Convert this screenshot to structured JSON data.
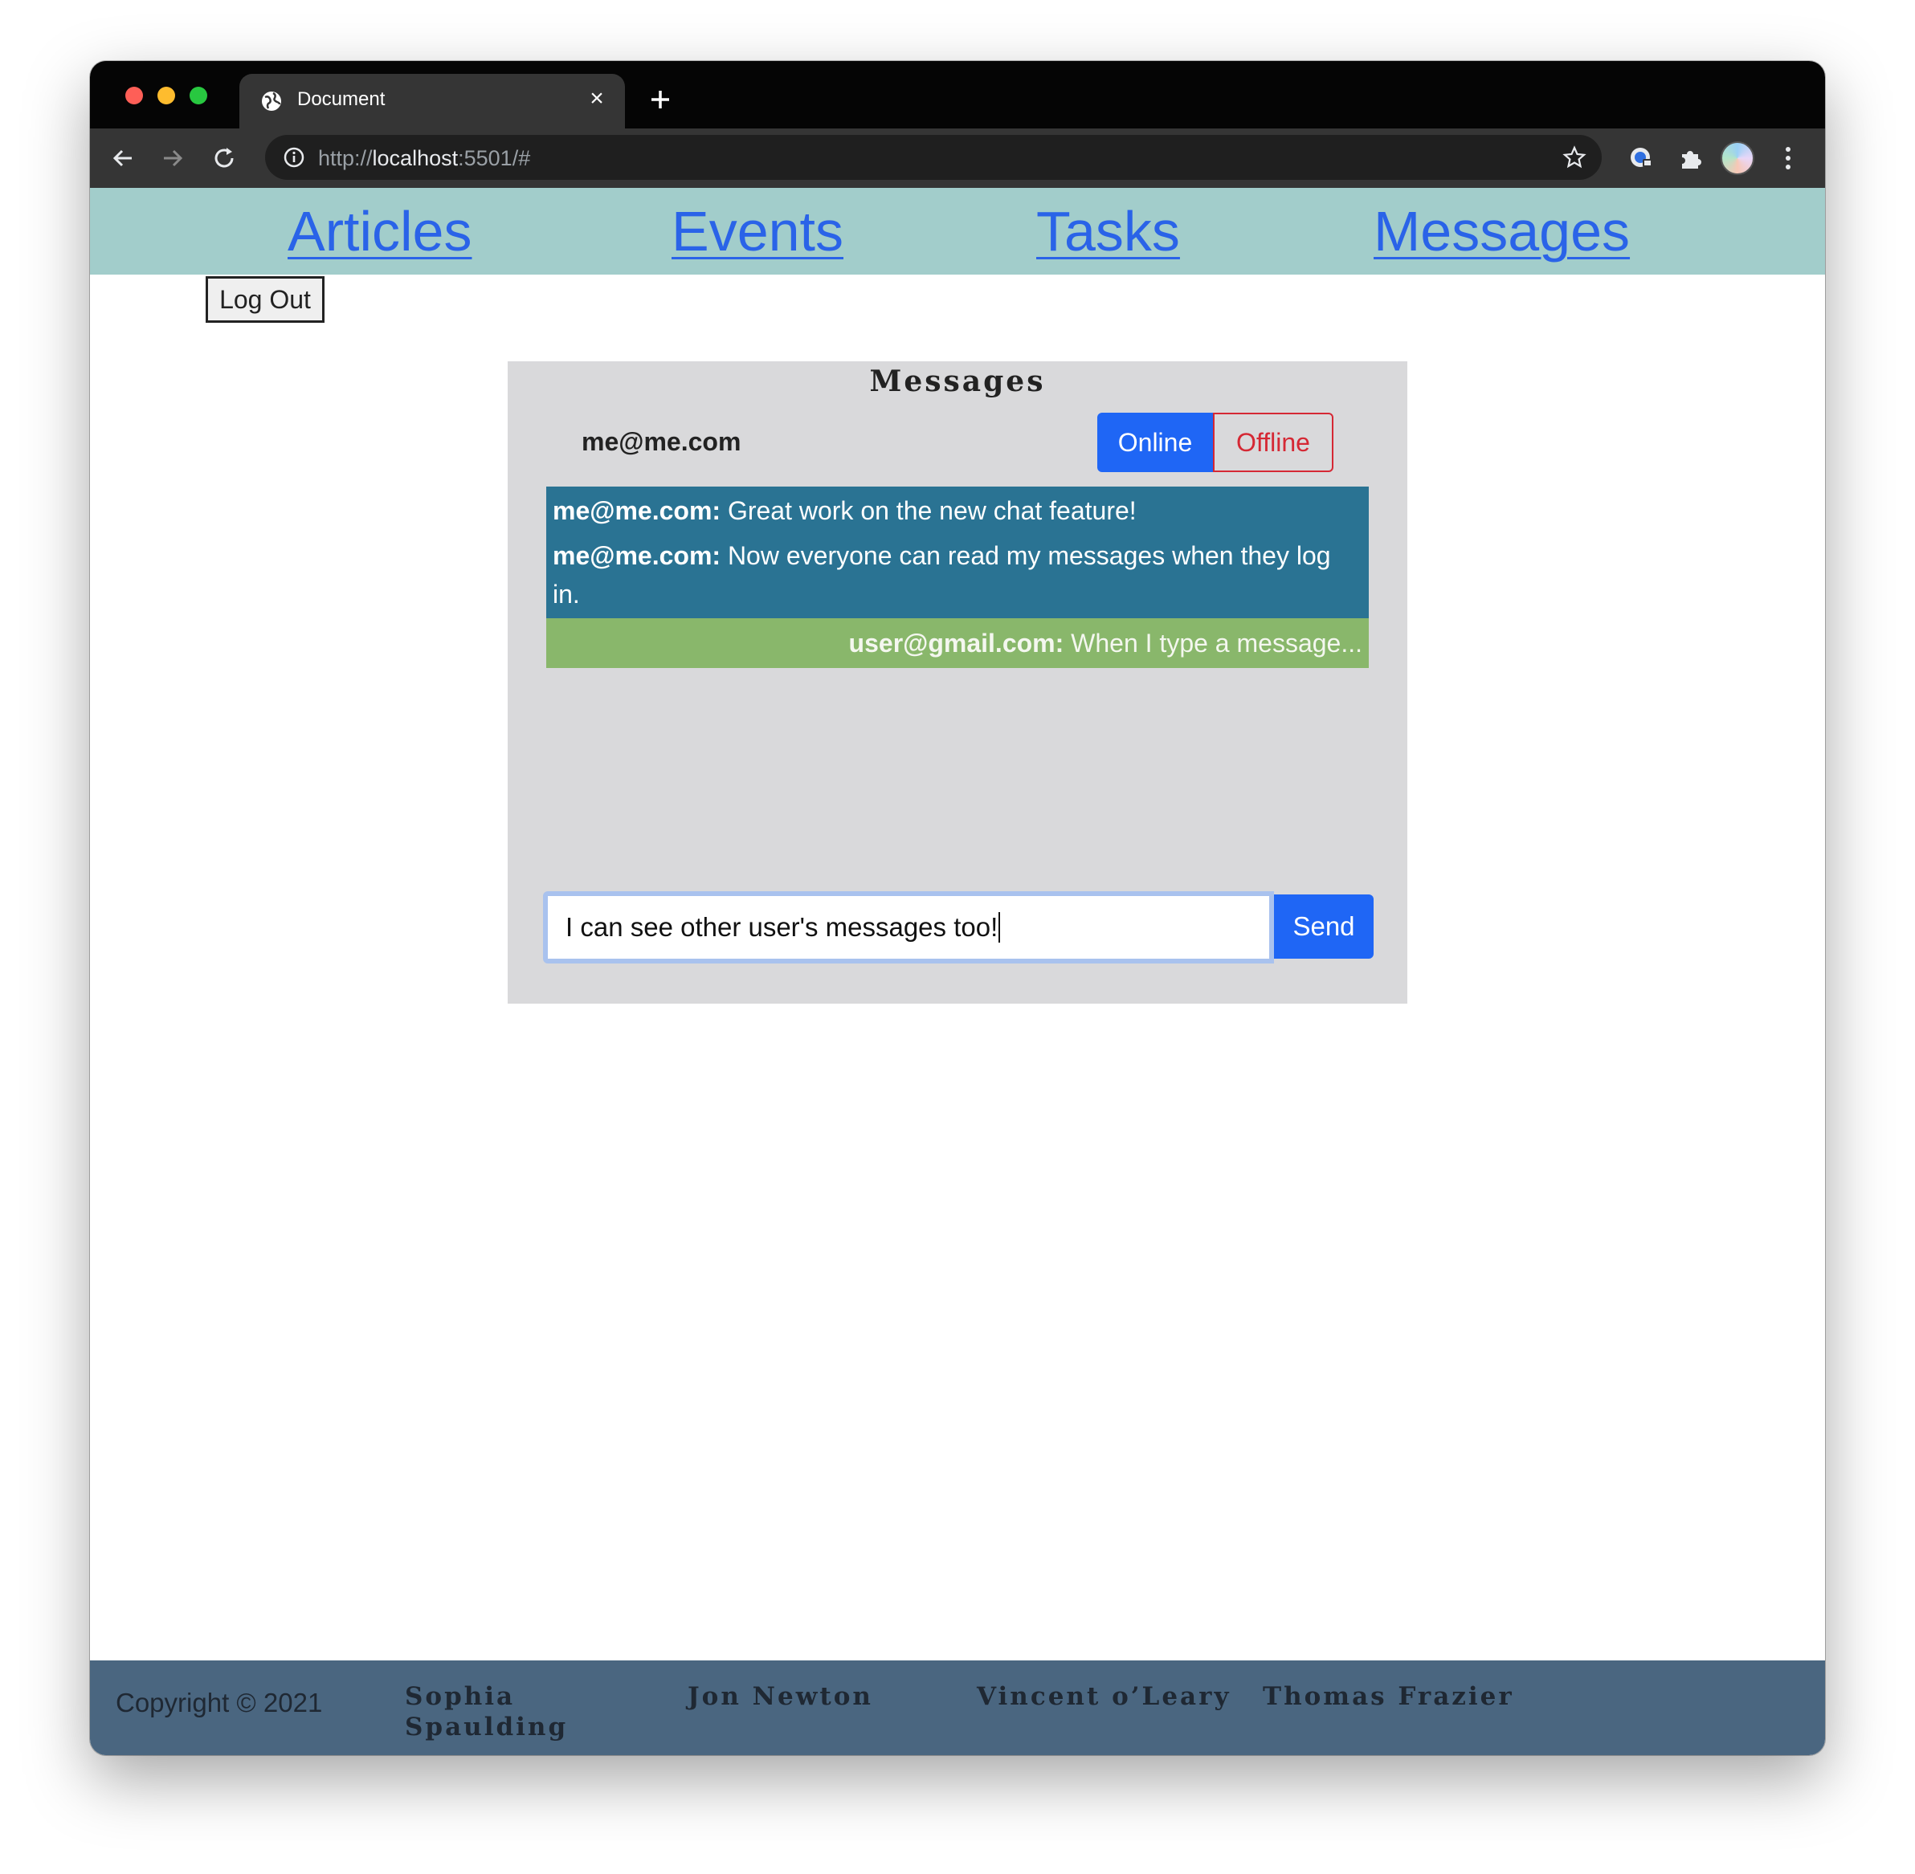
{
  "browser": {
    "tab_title": "Document",
    "url_scheme": "http://",
    "url_host": "localhost",
    "url_rest": ":5501/#"
  },
  "nav": {
    "links": [
      "Articles",
      "Events",
      "Tasks",
      "Messages"
    ]
  },
  "logout_label": "Log Out",
  "chat": {
    "title": "Messages",
    "current_user": "me@me.com",
    "online_label": "Online",
    "offline_label": "Offline",
    "messages": [
      {
        "sender": "me@me.com:",
        "text": " Great work on the new chat feature!"
      },
      {
        "sender": "me@me.com:",
        "text": " Now everyone can read my messages when they log in."
      },
      {
        "sender": "user@gmail.com:",
        "text": " When I type a message..."
      }
    ],
    "input_value": "I can see other user's messages too!",
    "send_label": "Send"
  },
  "footer": {
    "copyright": "Copyright © 2021",
    "authors": [
      "Sophia Spaulding",
      "Jon Newton",
      "Vincent o’Leary",
      "Thomas Frazier"
    ]
  },
  "colors": {
    "nav_bg": "#a2cdcb",
    "link": "#2a63e8",
    "chat_bg": "#d9d9db",
    "own_message_bg": "#2a7393",
    "other_message_bg": "#89b76b",
    "primary_button": "#1f66f5",
    "danger": "#d52834",
    "footer_bg": "#4a6680"
  }
}
